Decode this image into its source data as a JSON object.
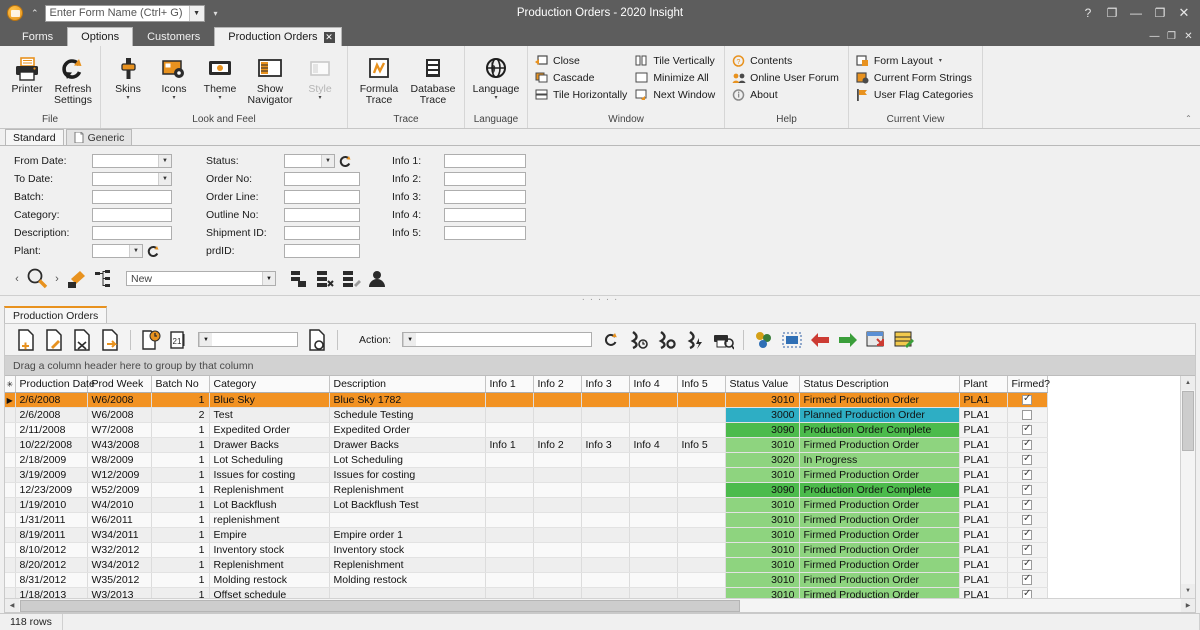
{
  "titlebar": {
    "app_icon": "app-orb-icon",
    "formname_placeholder": "Enter Form Name (Ctrl+ G)",
    "formname_value": "",
    "title": "Production Orders - 2020 Insight",
    "help_glyph": "?",
    "restore_glyph": "❐",
    "minimize_glyph": "—",
    "maximize_glyph": "❐",
    "close_glyph": "✕"
  },
  "ribbon_tabs": {
    "items": [
      {
        "label": "Forms",
        "active": false
      },
      {
        "label": "Options",
        "active": true
      },
      {
        "label": "Customers",
        "active": false
      }
    ],
    "document_tab": {
      "label": "Production Orders",
      "close_glyph": "✕"
    },
    "mdi": {
      "minimize": "—",
      "restore": "❐",
      "close": "✕"
    },
    "collapse_glyph": "⌃"
  },
  "ribbon": {
    "groups": [
      {
        "title": "File",
        "big_buttons": [
          {
            "label": "Printer",
            "icon": "printer-icon",
            "disabled": false,
            "caret": false
          },
          {
            "label": "Refresh Settings",
            "icon": "refresh-settings-icon",
            "disabled": false,
            "caret": false
          }
        ]
      },
      {
        "title": "Look and Feel",
        "big_buttons": [
          {
            "label": "Skins",
            "icon": "skins-icon",
            "disabled": false,
            "caret": true
          },
          {
            "label": "Icons",
            "icon": "icons-icon",
            "disabled": false,
            "caret": true
          },
          {
            "label": "Theme",
            "icon": "theme-icon",
            "disabled": false,
            "caret": true
          },
          {
            "label": "Show Navigator",
            "icon": "show-navigator-icon",
            "disabled": false,
            "caret": false
          },
          {
            "label": "Style",
            "icon": "style-icon",
            "disabled": true,
            "caret": true
          }
        ]
      },
      {
        "title": "Trace",
        "big_buttons": [
          {
            "label": "Formula Trace",
            "icon": "formula-trace-icon",
            "disabled": false,
            "caret": false
          },
          {
            "label": "Database Trace",
            "icon": "database-trace-icon",
            "disabled": false,
            "caret": false
          }
        ]
      },
      {
        "title": "Language",
        "big_buttons": [
          {
            "label": "Language",
            "icon": "language-globe-icon",
            "disabled": false,
            "caret": true
          }
        ]
      },
      {
        "title": "Window",
        "columns": [
          [
            {
              "label": "Close",
              "icon": "window-close-icon"
            },
            {
              "label": "Cascade",
              "icon": "cascade-icon"
            },
            {
              "label": "Tile Horizontally",
              "icon": "tile-horizontally-icon"
            }
          ],
          [
            {
              "label": "Tile Vertically",
              "icon": "tile-vertically-icon"
            },
            {
              "label": "Minimize All",
              "icon": "minimize-all-icon"
            },
            {
              "label": "Next Window",
              "icon": "next-window-icon"
            }
          ]
        ]
      },
      {
        "title": "Help",
        "columns": [
          [
            {
              "label": "Contents",
              "icon": "contents-help-icon"
            },
            {
              "label": "Online User Forum",
              "icon": "online-user-forum-icon"
            },
            {
              "label": "About",
              "icon": "about-info-icon"
            }
          ]
        ]
      },
      {
        "title": "Current View",
        "columns": [
          [
            {
              "label": "Form Layout",
              "icon": "form-layout-icon",
              "caret": true
            },
            {
              "label": "Current Form Strings",
              "icon": "current-form-strings-icon"
            },
            {
              "label": "User Flag Categories",
              "icon": "user-flag-categories-icon"
            }
          ]
        ]
      }
    ]
  },
  "filter_panel": {
    "tabs": [
      {
        "label": "Standard",
        "active": true,
        "icon": ""
      },
      {
        "label": "Generic",
        "active": false,
        "icon": "page-icon"
      }
    ],
    "column1": [
      {
        "label": "From Date:",
        "value": "",
        "dropdown": true
      },
      {
        "label": "To Date:",
        "value": "",
        "dropdown": true
      },
      {
        "label": "Batch:",
        "value": "",
        "dropdown": false
      },
      {
        "label": "Category:",
        "value": "",
        "dropdown": false
      },
      {
        "label": "Description:",
        "value": "",
        "dropdown": false
      },
      {
        "label": "Plant:",
        "value": "",
        "dropdown": true,
        "refresh": true
      }
    ],
    "column2": [
      {
        "label": "Status:",
        "value": "",
        "dropdown": true,
        "refresh": true
      },
      {
        "label": "Order No:",
        "value": "",
        "dropdown": false
      },
      {
        "label": "Order Line:",
        "value": "",
        "dropdown": false
      },
      {
        "label": "Outline No:",
        "value": "",
        "dropdown": false
      },
      {
        "label": "Shipment ID:",
        "value": "",
        "dropdown": false
      },
      {
        "label": "prdID:",
        "value": "",
        "dropdown": false
      }
    ],
    "column3": [
      {
        "label": "Info 1:",
        "value": ""
      },
      {
        "label": "Info 2:",
        "value": ""
      },
      {
        "label": "Info 3:",
        "value": ""
      },
      {
        "label": "Info 4:",
        "value": ""
      },
      {
        "label": "Info 5:",
        "value": ""
      }
    ]
  },
  "navbar": {
    "prev_glyph": "‹",
    "next_glyph": "›",
    "search_icon": "search-magnifier-icon",
    "paint_icon": "paint-brush-icon",
    "hierarchy_icon": "hierarchy-icon",
    "combo_value": "New",
    "right_icons": [
      "records-add-icon",
      "records-delete-icon",
      "records-edit-icon",
      "user-records-icon"
    ]
  },
  "document": {
    "tab_label": "Production Orders",
    "toolbar": {
      "icons": [
        "new-document-icon",
        "edit-document-icon",
        "cut-document-icon",
        "export-document-icon",
        "document-clock-icon",
        "document-sequence-icon"
      ],
      "combo_value": "",
      "after_combo_icon": "document-search-icon",
      "action_label": "Action:",
      "action_value": "",
      "action_refresh_icon": "refresh-icon",
      "right_icons": [
        "run-clock-icon",
        "run-gear-icon",
        "run-flash-icon",
        "print-preview-icon",
        "group-icon",
        "layers-icon",
        "import-red-icon",
        "export-green-icon",
        "export-grid-icon",
        "edit-grid-icon"
      ]
    }
  },
  "grid": {
    "group_bar_text": "Drag a column header here to group by that column",
    "columns": [
      "Production Date",
      "Prod Week",
      "Batch No",
      "Category",
      "Description",
      "Info 1",
      "Info 2",
      "Info 3",
      "Info 4",
      "Info 5",
      "Status Value",
      "Status Description",
      "Plant",
      "Firmed?"
    ],
    "rows": [
      {
        "date": "2/6/2008",
        "week": "W6/2008",
        "batch": "1",
        "category": "Blue Sky",
        "description": "Blue Sky 1782",
        "info1": "",
        "info2": "",
        "info3": "",
        "info4": "",
        "info5": "",
        "status_value": "3010",
        "status_desc": "Firmed Production Order",
        "plant": "PLA1",
        "firmed": true,
        "selected": true,
        "status_color": "#f29222"
      },
      {
        "date": "2/6/2008",
        "week": "W6/2008",
        "batch": "2",
        "category": "Test",
        "description": "Schedule Testing",
        "info1": "",
        "info2": "",
        "info3": "",
        "info4": "",
        "info5": "",
        "status_value": "3000",
        "status_desc": "Planned Production Order",
        "plant": "PLA1",
        "firmed": false,
        "selected": false,
        "status_color": "#2eaec4"
      },
      {
        "date": "2/11/2008",
        "week": "W7/2008",
        "batch": "1",
        "category": "Expedited Order",
        "description": "Expedited Order",
        "info1": "",
        "info2": "",
        "info3": "",
        "info4": "",
        "info5": "",
        "status_value": "3090",
        "status_desc": "Production Order Complete",
        "plant": "PLA1",
        "firmed": true,
        "selected": false,
        "status_color": "#4cbb4c"
      },
      {
        "date": "10/22/2008",
        "week": "W43/2008",
        "batch": "1",
        "category": "Drawer Backs",
        "description": "Drawer Backs",
        "info1": "Info 1",
        "info2": "Info 2",
        "info3": "Info 3",
        "info4": "Info 4",
        "info5": "Info 5",
        "status_value": "3010",
        "status_desc": "Firmed Production Order",
        "plant": "PLA1",
        "firmed": true,
        "selected": false,
        "status_color": "#8ed47f"
      },
      {
        "date": "2/18/2009",
        "week": "W8/2009",
        "batch": "1",
        "category": "Lot Scheduling",
        "description": "Lot Scheduling",
        "info1": "",
        "info2": "",
        "info3": "",
        "info4": "",
        "info5": "",
        "status_value": "3020",
        "status_desc": "In Progress",
        "plant": "PLA1",
        "firmed": true,
        "selected": false,
        "status_color": "#8ed47f"
      },
      {
        "date": "3/19/2009",
        "week": "W12/2009",
        "batch": "1",
        "category": "Issues for costing",
        "description": "Issues for costing",
        "info1": "",
        "info2": "",
        "info3": "",
        "info4": "",
        "info5": "",
        "status_value": "3010",
        "status_desc": "Firmed Production Order",
        "plant": "PLA1",
        "firmed": true,
        "selected": false,
        "status_color": "#8ed47f"
      },
      {
        "date": "12/23/2009",
        "week": "W52/2009",
        "batch": "1",
        "category": "Replenishment",
        "description": "Replenishment",
        "info1": "",
        "info2": "",
        "info3": "",
        "info4": "",
        "info5": "",
        "status_value": "3090",
        "status_desc": "Production Order Complete",
        "plant": "PLA1",
        "firmed": true,
        "selected": false,
        "status_color": "#4cbb4c"
      },
      {
        "date": "1/19/2010",
        "week": "W4/2010",
        "batch": "1",
        "category": "Lot Backflush",
        "description": "Lot Backflush Test",
        "info1": "",
        "info2": "",
        "info3": "",
        "info4": "",
        "info5": "",
        "status_value": "3010",
        "status_desc": "Firmed Production Order",
        "plant": "PLA1",
        "firmed": true,
        "selected": false,
        "status_color": "#8ed47f"
      },
      {
        "date": "1/31/2011",
        "week": "W6/2011",
        "batch": "1",
        "category": "replenishment",
        "description": "",
        "info1": "",
        "info2": "",
        "info3": "",
        "info4": "",
        "info5": "",
        "status_value": "3010",
        "status_desc": "Firmed Production Order",
        "plant": "PLA1",
        "firmed": true,
        "selected": false,
        "status_color": "#8ed47f"
      },
      {
        "date": "8/19/2011",
        "week": "W34/2011",
        "batch": "1",
        "category": "Empire",
        "description": "Empire order 1",
        "info1": "",
        "info2": "",
        "info3": "",
        "info4": "",
        "info5": "",
        "status_value": "3010",
        "status_desc": "Firmed Production Order",
        "plant": "PLA1",
        "firmed": true,
        "selected": false,
        "status_color": "#8ed47f"
      },
      {
        "date": "8/10/2012",
        "week": "W32/2012",
        "batch": "1",
        "category": "Inventory stock",
        "description": "Inventory stock",
        "info1": "",
        "info2": "",
        "info3": "",
        "info4": "",
        "info5": "",
        "status_value": "3010",
        "status_desc": "Firmed Production Order",
        "plant": "PLA1",
        "firmed": true,
        "selected": false,
        "status_color": "#8ed47f"
      },
      {
        "date": "8/20/2012",
        "week": "W34/2012",
        "batch": "1",
        "category": "Replenishment",
        "description": "Replenishment",
        "info1": "",
        "info2": "",
        "info3": "",
        "info4": "",
        "info5": "",
        "status_value": "3010",
        "status_desc": "Firmed Production Order",
        "plant": "PLA1",
        "firmed": true,
        "selected": false,
        "status_color": "#8ed47f"
      },
      {
        "date": "8/31/2012",
        "week": "W35/2012",
        "batch": "1",
        "category": "Molding restock",
        "description": "Molding restock",
        "info1": "",
        "info2": "",
        "info3": "",
        "info4": "",
        "info5": "",
        "status_value": "3010",
        "status_desc": "Firmed Production Order",
        "plant": "PLA1",
        "firmed": true,
        "selected": false,
        "status_color": "#8ed47f"
      },
      {
        "date": "1/18/2013",
        "week": "W3/2013",
        "batch": "1",
        "category": "Offset schedule",
        "description": "",
        "info1": "",
        "info2": "",
        "info3": "",
        "info4": "",
        "info5": "",
        "status_value": "3010",
        "status_desc": "Firmed Production Order",
        "plant": "PLA1",
        "firmed": true,
        "selected": false,
        "status_color": "#8ed47f"
      }
    ]
  },
  "statusbar": {
    "row_count": "118 rows"
  },
  "colors": {
    "accent_orange": "#f29222",
    "chrome_gray": "#5d5d5d",
    "status_planned": "#2eaec4",
    "status_complete": "#4cbb4c",
    "status_firmed": "#8ed47f"
  }
}
